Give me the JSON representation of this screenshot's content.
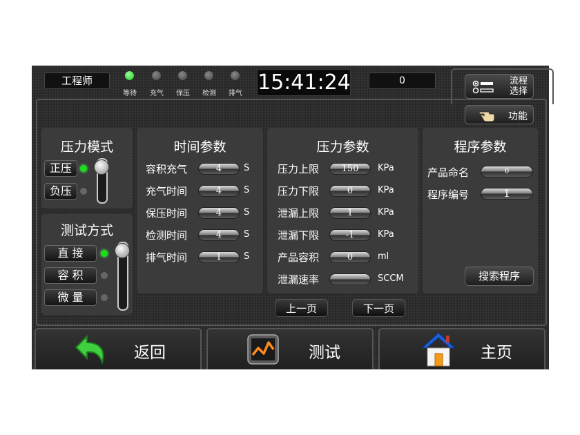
{
  "header": {
    "role": "工程师",
    "time": "15:41:24",
    "counter": "0",
    "stages": [
      {
        "label": "等待",
        "active": true
      },
      {
        "label": "充气",
        "active": false
      },
      {
        "label": "保压",
        "active": false
      },
      {
        "label": "检测",
        "active": false
      },
      {
        "label": "排气",
        "active": false
      }
    ],
    "flow_line1": "流程",
    "flow_line2": "选择",
    "function": "功能"
  },
  "pressure_mode": {
    "title": "压力模式",
    "options": [
      "正压",
      "负压"
    ],
    "selected": "正压"
  },
  "test_mode": {
    "title": "测试方式",
    "options": [
      "直 接",
      "容 积",
      "微 量"
    ],
    "selected": "直 接"
  },
  "time_params": {
    "title": "时间参数",
    "rows": [
      {
        "label": "容积充气",
        "value": "4",
        "unit": "S"
      },
      {
        "label": "充气时间",
        "value": "4",
        "unit": "S"
      },
      {
        "label": "保压时间",
        "value": "4",
        "unit": "S"
      },
      {
        "label": "检测时间",
        "value": "4",
        "unit": "S"
      },
      {
        "label": "排气时间",
        "value": "1",
        "unit": "S"
      }
    ]
  },
  "pressure_params": {
    "title": "压力参数",
    "rows": [
      {
        "label": "压力上限",
        "value": "150",
        "unit": "KPa"
      },
      {
        "label": "压力下限",
        "value": "0",
        "unit": "KPa"
      },
      {
        "label": "泄漏上限",
        "value": "1",
        "unit": "KPa"
      },
      {
        "label": "泄漏下限",
        "value": "-1",
        "unit": "KPa"
      },
      {
        "label": "产品容积",
        "value": "0",
        "unit": "ml"
      },
      {
        "label": "泄漏速率",
        "value": "",
        "unit": "SCCM"
      }
    ],
    "prev_page": "上一页",
    "next_page": "下一页"
  },
  "program_params": {
    "title": "程序参数",
    "name_label": "产品命名",
    "name_value": "0",
    "number_label": "程序编号",
    "number_value": "1",
    "search": "搜索程序"
  },
  "footer": {
    "back": "返回",
    "test": "测试",
    "home": "主页"
  },
  "colors": {
    "lamp_on": "#19c519",
    "accent_green": "#3fcf3f",
    "home_roof": "#1d5fd6"
  }
}
